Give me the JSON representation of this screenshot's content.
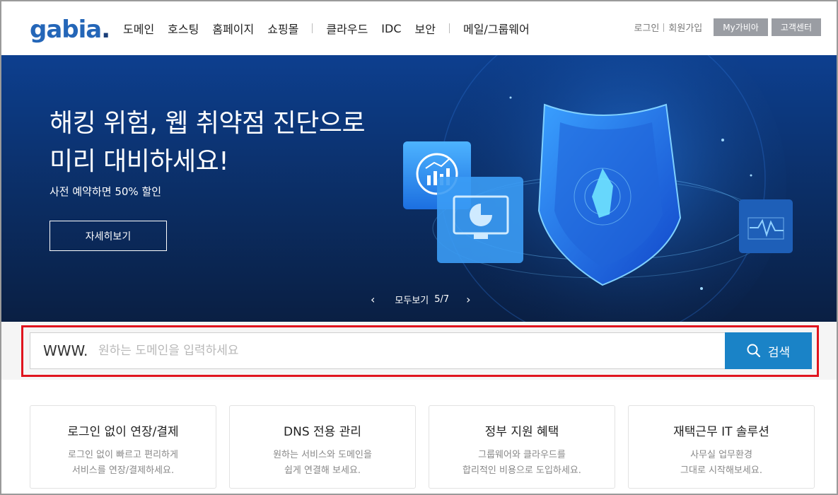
{
  "header": {
    "logo": "gabia",
    "logo_dot": ".",
    "nav": [
      "도메인",
      "호스팅",
      "홈페이지",
      "쇼핑몰",
      "클라우드",
      "IDC",
      "보안",
      "메일/그룹웨어"
    ],
    "util": {
      "login": "로그인",
      "signup": "회원가입",
      "my": "My가비아",
      "support": "고객센터"
    }
  },
  "hero": {
    "title_line1": "해킹 위험, 웹 취약점 진단으로",
    "title_line2": "미리 대비하세요!",
    "subtitle": "사전 예약하면 50% 할인",
    "button": "자세히보기",
    "control_label": "모두보기",
    "control_count": "5/7",
    "prev_icon": "chevron-left-icon",
    "next_icon": "chevron-right-icon"
  },
  "search": {
    "prefix": "WWW.",
    "placeholder": "원하는 도메인을 입력하세요",
    "button": "검색",
    "button_color": "#1a83c7",
    "highlight_color": "#e0141e"
  },
  "cards": [
    {
      "title": "로그인 없이 연장/결제",
      "desc1": "로그인 없이 빠르고 편리하게",
      "desc2": "서비스를 연장/결제하세요."
    },
    {
      "title": "DNS 전용 관리",
      "desc1": "원하는 서비스와 도메인을",
      "desc2": "쉽게 연결해 보세요."
    },
    {
      "title": "정부 지원 혜택",
      "desc1": "그룹웨어와 클라우드를",
      "desc2": "합리적인 비용으로 도입하세요."
    },
    {
      "title": "재택근무 IT 솔루션",
      "desc1": "사무실 업무환경",
      "desc2": "그대로 시작해보세요."
    }
  ],
  "colors": {
    "brand": "#2466b8",
    "hero_bg": "#0b2d63"
  }
}
